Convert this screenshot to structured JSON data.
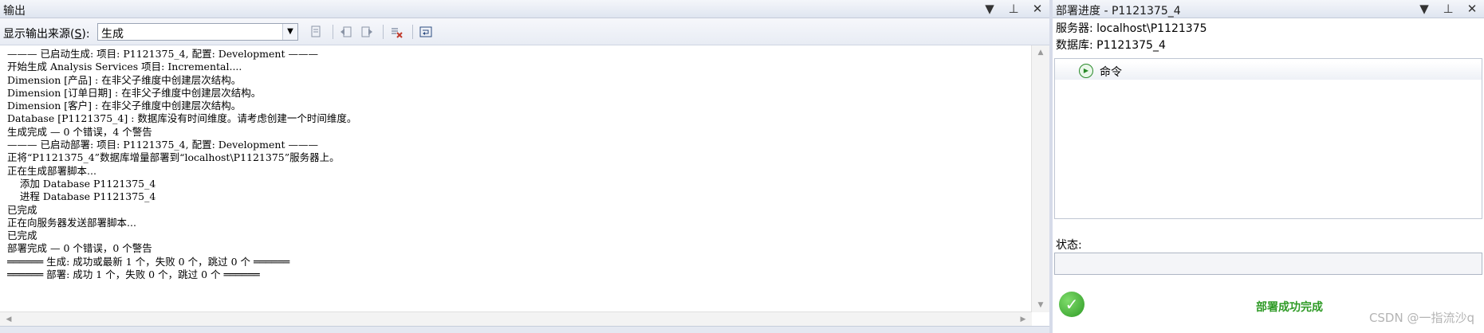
{
  "output_panel": {
    "title": "输出",
    "title_buttons": [
      "▼",
      "⊥",
      "✕"
    ],
    "source_label_prefix": "显示输出来源(",
    "source_label_key": "S",
    "source_label_suffix": "):",
    "source_value": "生成",
    "toolbar_icons": [
      "find-message-icon",
      "go-previous-icon",
      "go-next-icon",
      "clear-all-icon",
      "toggle-word-wrap-icon"
    ],
    "log_lines": [
      "——— 已启动生成: 项目: P1121375_4, 配置: Development ———",
      "开始生成 Analysis Services 项目: Incremental....",
      "Dimension [产品] : 在非父子维度中创建层次结构。",
      "Dimension [订单日期] : 在非父子维度中创建层次结构。",
      "Dimension [客户] : 在非父子维度中创建层次结构。",
      "Database [P1121375_4] : 数据库没有时间维度。请考虑创建一个时间维度。",
      "生成完成 — 0 个错误，4 个警告",
      "——— 已启动部署: 项目: P1121375_4, 配置: Development ———",
      "正将“P1121375_4”数据库增量部署到“localhost\\P1121375”服务器上。",
      "正在生成部署脚本...",
      "    添加 Database P1121375_4",
      "    进程 Database P1121375_4",
      "已完成",
      "正在向服务器发送部署脚本...",
      "已完成",
      "部署完成 — 0 个错误，0 个警告",
      "══════ 生成: 成功或最新 1 个，失败 0 个，跳过 0 个 ══════",
      "══════ 部署: 成功 1 个，失败 0 个，跳过 0 个 ══════"
    ]
  },
  "deploy_panel": {
    "title": "部署进度 - P1121375_4",
    "title_buttons": [
      "▼",
      "⊥",
      "✕"
    ],
    "server_line": "服务器: localhost\\P1121375",
    "database_line": "数据库: P1121375_4",
    "tree_item": "命令",
    "status_label": "状态:",
    "status_value": "",
    "success_text": "部署成功完成"
  },
  "watermark": "CSDN @一指流沙q",
  "colors": {
    "success_green": "#2e9a25",
    "panel_bg": "#ffffff",
    "chrome": "#d6dbe9"
  }
}
